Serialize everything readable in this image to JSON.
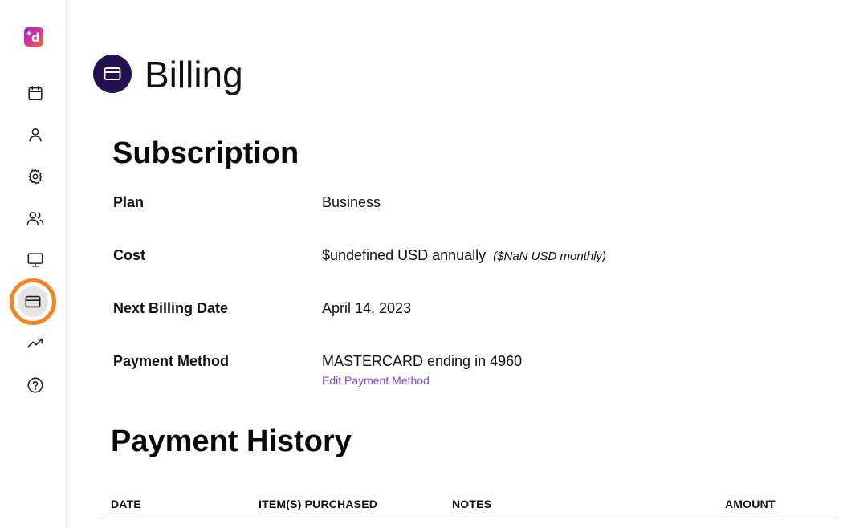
{
  "logo": {
    "letter": "d",
    "spark": "✦"
  },
  "sidebar": {
    "items": [
      {
        "name": "calendar",
        "icon": "calendar-icon"
      },
      {
        "name": "profile",
        "icon": "user-icon"
      },
      {
        "name": "settings",
        "icon": "gear-icon"
      },
      {
        "name": "team",
        "icon": "users-icon"
      },
      {
        "name": "display",
        "icon": "monitor-icon"
      },
      {
        "name": "billing",
        "icon": "credit-card-icon",
        "active": true
      },
      {
        "name": "analytics",
        "icon": "trending-up-icon"
      },
      {
        "name": "help",
        "icon": "help-circle-icon"
      }
    ],
    "active_highlight_color": "#f5841f"
  },
  "header": {
    "title": "Billing",
    "icon": "credit-card-icon",
    "icon_bg": "#241152"
  },
  "subscription": {
    "title": "Subscription",
    "rows": [
      {
        "label": "Plan",
        "value": "Business"
      },
      {
        "label": "Cost",
        "value": "$undefined USD annually",
        "note": "($NaN USD monthly)"
      },
      {
        "label": "Next Billing Date",
        "value": "April 14, 2023"
      },
      {
        "label": "Payment Method",
        "value": "MASTERCARD ending in 4960"
      }
    ],
    "edit_payment_link": "Edit Payment Method",
    "link_color": "#7a45e0"
  },
  "payment_history": {
    "title": "Payment History",
    "columns": [
      "DATE",
      "ITEM(S) PURCHASED",
      "NOTES",
      "AMOUNT"
    ]
  }
}
